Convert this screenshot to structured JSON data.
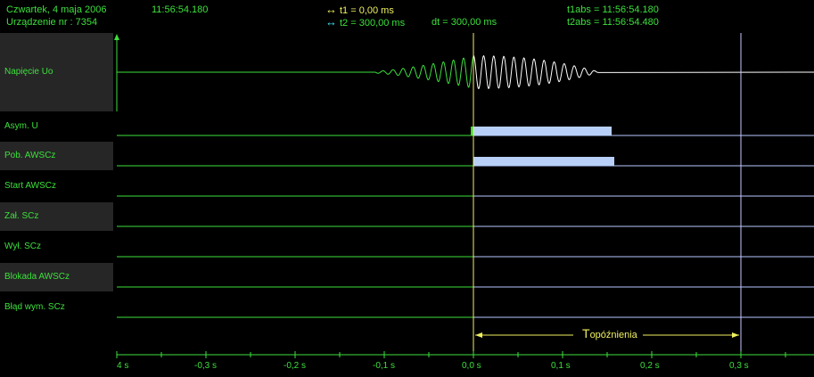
{
  "header": {
    "date": "Czwartek,  4  maja  2006",
    "time": "11:56:54.180",
    "device": "Urządzenie nr :  7354",
    "t1": "t1 = 0,00 ms",
    "t2": "t2 = 300,00 ms",
    "dt": "dt = 300,00 ms",
    "t1abs": "t1abs = 11:56:54.180",
    "t2abs": "t2abs = 11:56:54.480",
    "cursor_colors": {
      "t1": "#f0f060",
      "t2": "#40e0f0"
    }
  },
  "channels": [
    {
      "label": "Napięcie Uo",
      "type": "analog"
    },
    {
      "label": "Asym. U",
      "type": "binary",
      "active": [
        0.0,
        0.155
      ]
    },
    {
      "label": "Pob. AWSCz",
      "type": "binary",
      "active": [
        0.0,
        0.158
      ]
    },
    {
      "label": "Start AWSCz",
      "type": "binary",
      "active": []
    },
    {
      "label": "Zał. SCz",
      "type": "binary",
      "active": []
    },
    {
      "label": "Wył. SCz",
      "type": "binary",
      "active": []
    },
    {
      "label": "Blokada AWSCz",
      "type": "binary",
      "active": []
    },
    {
      "label": "Błąd wym. SCz",
      "type": "binary",
      "active": []
    }
  ],
  "delay_label": {
    "main": "T",
    "sub": "opóźnienia"
  },
  "axis": {
    "tick_labels": [
      "4 s",
      "-0,3 s",
      "-0,2 s",
      "-0,1 s",
      "0,0 s",
      "0,1 s",
      "0,2 s",
      "0,3 s"
    ],
    "tick_values": [
      -0.4,
      -0.3,
      -0.2,
      -0.1,
      0.0,
      0.1,
      0.2,
      0.3
    ],
    "range": [
      -0.4,
      0.383
    ]
  },
  "cursors": {
    "t1_s": 0.0,
    "t2_s": 0.3
  },
  "colors": {
    "trace": "#3ce03c",
    "trace_after": "#ffffff",
    "baseline_after": "#b8c8ff",
    "bar": "#b8d0f8",
    "cursor": "#f0f060",
    "cursor2": "#c8c8ff"
  }
}
